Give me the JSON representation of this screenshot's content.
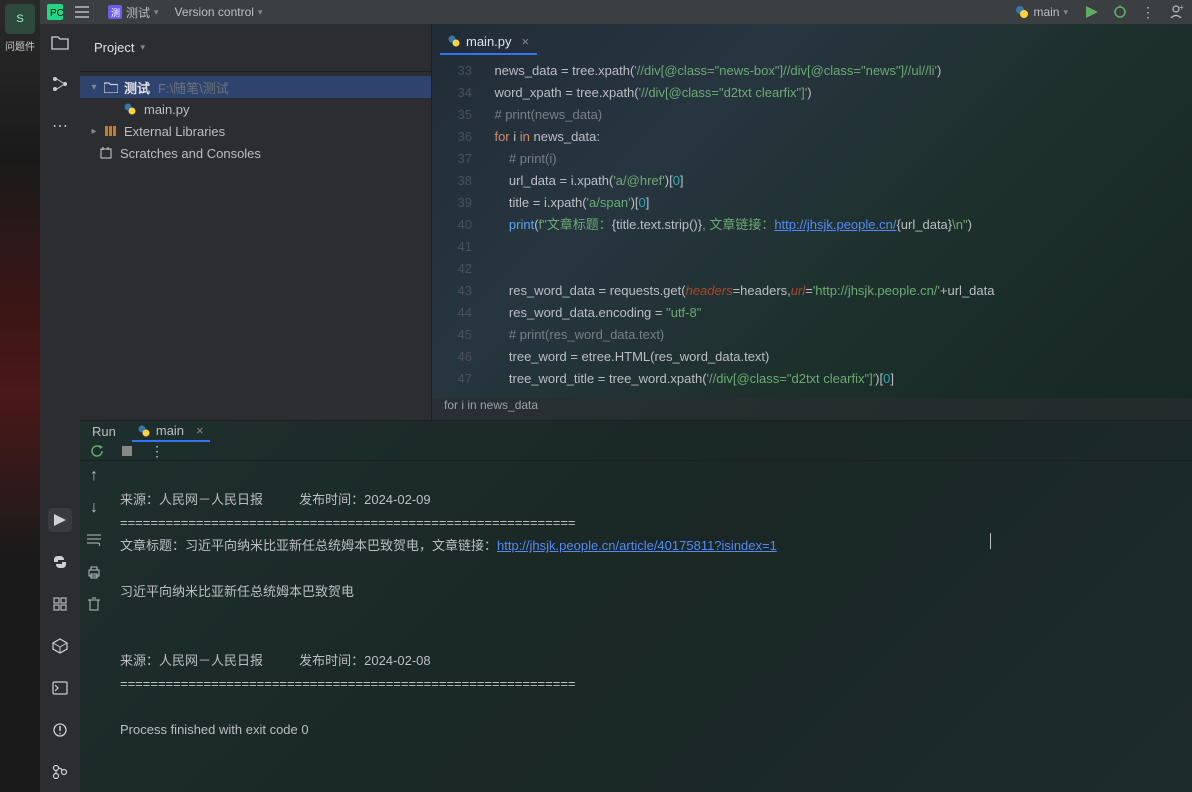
{
  "desktop": {
    "icon_label": "S",
    "caption": "问题件"
  },
  "titlebar": {
    "project_name": "测试",
    "menu_vcs": "Version control",
    "run_config": "main"
  },
  "project": {
    "header": "Project",
    "root_name": "测试",
    "root_path": "F:\\随笔\\测试",
    "file_main": "main.py",
    "external": "External Libraries",
    "scratches": "Scratches and Consoles"
  },
  "editor": {
    "tab_name": "main.py",
    "breadcrumb": "for i in news_data",
    "lines": [
      {
        "n": 33,
        "t": "    news_data = tree.xpath(<s>'//div[@class=\"news-box\"]//div[@class=\"news\"]//ul//li'</s>)"
      },
      {
        "n": 34,
        "t": "    word_xpath = tree.xpath(<s>'//div[@class=\"d2txt clearfix\"]'</s>)"
      },
      {
        "n": 35,
        "t": "    <c># print(news_data)</c>"
      },
      {
        "n": 36,
        "t": "    <k>for</k> i <k>in</k> news_data:"
      },
      {
        "n": 37,
        "t": "        <c># print(i)</c>"
      },
      {
        "n": 38,
        "t": "        url_data = i.xpath(<s>'a/@href'</s>)[<n>0</n>]"
      },
      {
        "n": 39,
        "t": "        title = i.xpath(<s>'a/span'</s>)[<n>0</n>]"
      },
      {
        "n": 40,
        "t": "        <f>print</f>(<s>f\"文章标题：</s>{title.text.strip()}<s>, 文章链接：</s><u>http://jhsjk.people.cn/</u>{url_data}<s>\\n\"</s>)"
      },
      {
        "n": 41,
        "t": ""
      },
      {
        "n": 42,
        "t": ""
      },
      {
        "n": 43,
        "t": "        res_word_data = requests.get(<p>headers</p>=headers,<p>url</p>=<s>'http://jhsjk.people.cn/'</s>+url_data"
      },
      {
        "n": 44,
        "t": "        res_word_data.encoding = <s>\"utf-8\"</s>"
      },
      {
        "n": 45,
        "t": "        <c># print(res_word_data.text)</c>"
      },
      {
        "n": 46,
        "t": "        tree_word = etree.HTML(res_word_data.text)"
      },
      {
        "n": 47,
        "t": "        tree_word_title = tree_word.xpath(<s>'//div[@class=\"d2txt clearfix\"]'</s>)[<n>0</n>]"
      }
    ]
  },
  "run": {
    "label": "Run",
    "tab": "main",
    "output": {
      "l1": "来源：人民网－人民日报          发布时间：2024-02-09",
      "l2": "============================================================",
      "l3_pre": "文章标题：习近平向纳米比亚新任总统姆本巴致贺电，文章链接：",
      "l3_url": "http://jhsjk.people.cn/article/40175811?isindex=1",
      "l4": "",
      "l5": "习近平向纳米比亚新任总统姆本巴致贺电",
      "l6": "",
      "l7": "",
      "l8": "来源：人民网－人民日报          发布时间：2024-02-08",
      "l9": "============================================================",
      "l10": "",
      "l11": "Process finished with exit code 0"
    }
  }
}
